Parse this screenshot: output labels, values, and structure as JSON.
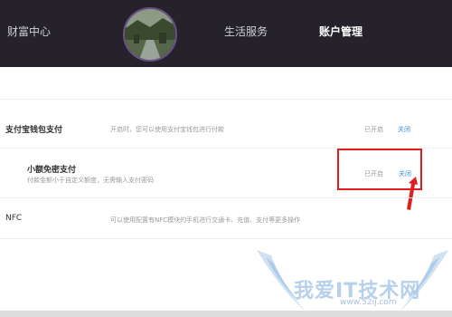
{
  "nav": {
    "items": [
      {
        "label": "财富中心"
      },
      {
        "label": "生活服务"
      },
      {
        "label": "账户管理"
      }
    ],
    "active": "账户管理"
  },
  "settings": {
    "rows": [
      {
        "title": "支付宝钱包支付",
        "description": "开启时，您可以使用支付宝钱包进行付款",
        "status": "已开启",
        "action": "关闭"
      },
      {
        "title": "小额免密支付",
        "description": "付款金额小于自定义额度，无需输入支付密码",
        "status": "已开启",
        "action": "关闭"
      },
      {
        "title": "NFC",
        "description": "可以使用配置有NFC模块的手机进行交通卡、充值、支付等更多操作"
      }
    ]
  },
  "watermark": {
    "text": "我爱IT技术网",
    "url": "www.52ij.com"
  },
  "colors": {
    "nav_bg": "#25222c",
    "link": "#3a8fd9",
    "highlight": "#e21d1d"
  }
}
